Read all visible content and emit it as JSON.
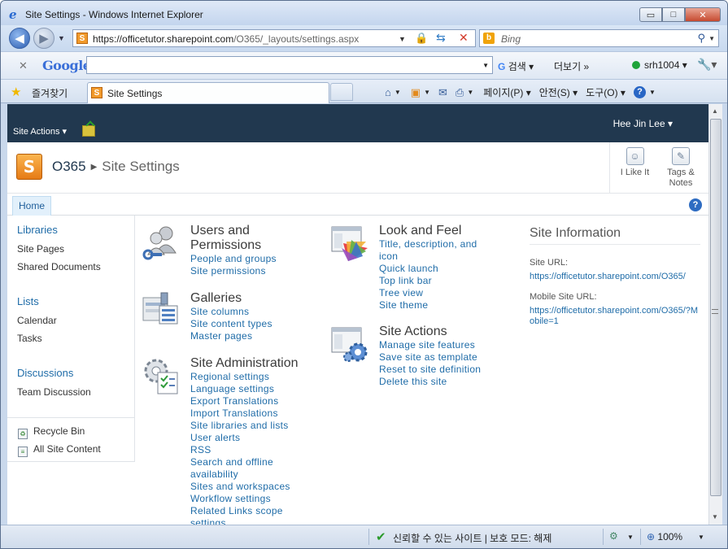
{
  "window": {
    "title": "Site Settings - Windows Internet Explorer",
    "min_glyph": "▭",
    "max_glyph": "□",
    "close_glyph": "✕"
  },
  "navigation": {
    "url_host": "https://officetutor.sharepoint.com",
    "url_path": "/O365/_layouts/settings.aspx",
    "search_placeholder": "Bing"
  },
  "google_toolbar": {
    "logo": "Google",
    "search_label": "검색",
    "more_label": "더보기 »",
    "user_label": "srh1004"
  },
  "favorites_bar": {
    "favorites_label": "즐겨찾기",
    "tab_title": "Site Settings",
    "page_label": "페이지(P)",
    "safety_label": "안전(S)",
    "tools_label": "도구(O)"
  },
  "sharepoint": {
    "site_actions_label": "Site Actions",
    "user_name": "Hee Jin Lee",
    "logo_letter": "S",
    "breadcrumb": {
      "root": "O365",
      "current": "Site Settings"
    },
    "social": {
      "like_label": "I Like It",
      "tags_label": "Tags & Notes"
    },
    "topnav": {
      "home_label": "Home"
    },
    "quick_launch": {
      "libraries_heading": "Libraries",
      "libraries": [
        "Site Pages",
        "Shared Documents"
      ],
      "lists_heading": "Lists",
      "lists": [
        "Calendar",
        "Tasks"
      ],
      "discussions_heading": "Discussions",
      "discussions": [
        "Team Discussion"
      ],
      "recycle_bin": "Recycle Bin",
      "all_site_content": "All Site Content"
    },
    "groups": {
      "users": {
        "title": "Users and Permissions",
        "links": [
          "People and groups",
          "Site permissions"
        ]
      },
      "galleries": {
        "title": "Galleries",
        "links": [
          "Site columns",
          "Site content types",
          "Master pages"
        ]
      },
      "admin": {
        "title": "Site Administration",
        "links": [
          "Regional settings",
          "Language settings",
          "Export Translations",
          "Import Translations",
          "Site libraries and lists",
          "User alerts",
          "RSS",
          "Search and offline availability",
          "Sites and workspaces",
          "Workflow settings",
          "Related Links scope settings"
        ]
      },
      "look": {
        "title": "Look and Feel",
        "links": [
          "Title, description, and icon",
          "Quick launch",
          "Top link bar",
          "Tree view",
          "Site theme"
        ]
      },
      "actions": {
        "title": "Site Actions",
        "links": [
          "Manage site features",
          "Save site as template",
          "Reset to site definition",
          "Delete this site"
        ]
      }
    },
    "site_information": {
      "heading": "Site Information",
      "site_url_label": "Site URL:",
      "site_url": "https://officetutor.sharepoint.com/O365/",
      "mobile_url_label": "Mobile Site URL:",
      "mobile_url": "https://officetutor.sharepoint.com/O365/?Mobile=1"
    }
  },
  "status_bar": {
    "zone_text": "신뢰할 수 있는 사이트 | 보호 모드: 해제",
    "zoom": "100%"
  },
  "colors": {
    "ribbon": "#21384f",
    "link": "#1f6ca8",
    "accent_orange": "#e67b16"
  }
}
